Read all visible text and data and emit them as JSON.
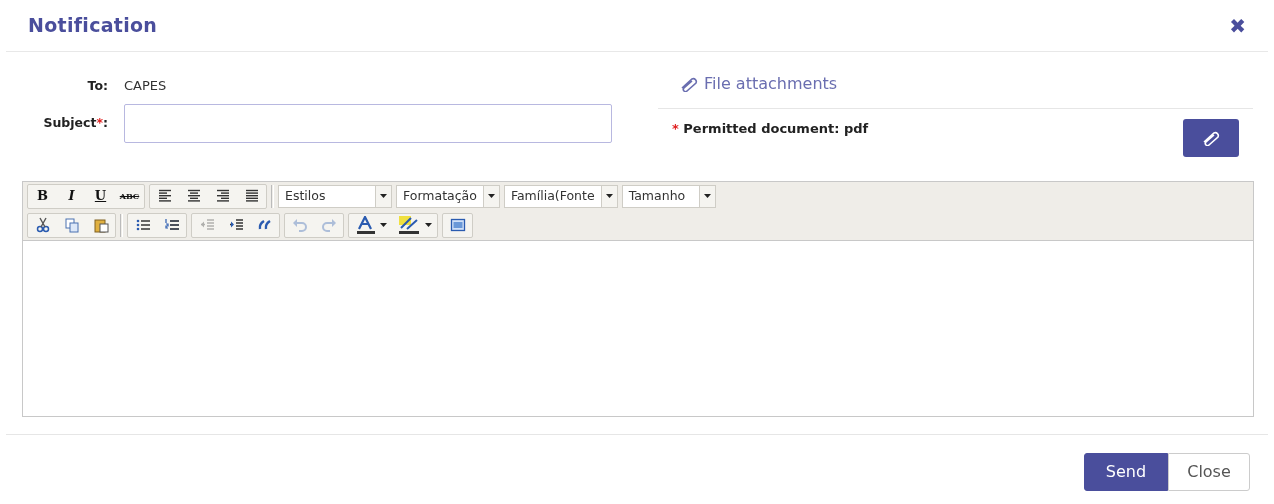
{
  "dialog": {
    "title": "Notification",
    "close_label": "✖"
  },
  "to": {
    "label": "To:",
    "value": "CAPES"
  },
  "subject": {
    "label": "Subject",
    "required_mark": "*",
    "colon": ":"
  },
  "attachments": {
    "heading": "File attachments",
    "required_mark": "*",
    "note": "Permitted document: pdf"
  },
  "editor": {
    "toolbar_rows": [
      [
        {
          "kind": "group",
          "buttons": [
            {
              "kind": "bold",
              "label": "B",
              "disabled": false
            },
            {
              "kind": "italic",
              "label": "I",
              "disabled": false
            },
            {
              "kind": "underline",
              "label": "U",
              "disabled": false
            },
            {
              "kind": "strike",
              "label": "ABC",
              "disabled": false
            }
          ]
        },
        {
          "kind": "group",
          "buttons": [
            {
              "kind": "align-left",
              "disabled": false
            },
            {
              "kind": "align-center",
              "disabled": false
            },
            {
              "kind": "align-right",
              "disabled": false
            },
            {
              "kind": "justify",
              "disabled": false
            }
          ]
        },
        {
          "kind": "separator"
        },
        {
          "kind": "combo",
          "label": "Estilos"
        },
        {
          "kind": "combo",
          "label": "Formatação"
        },
        {
          "kind": "combo",
          "label": "Família(Fonte"
        },
        {
          "kind": "combo",
          "label": "Tamanho"
        }
      ],
      [
        {
          "kind": "group",
          "buttons": [
            {
              "kind": "cut",
              "disabled": false
            },
            {
              "kind": "copy",
              "disabled": false
            },
            {
              "kind": "paste",
              "disabled": false
            }
          ]
        },
        {
          "kind": "separator"
        },
        {
          "kind": "group",
          "buttons": [
            {
              "kind": "bullets",
              "disabled": false
            },
            {
              "kind": "numbers",
              "disabled": false
            }
          ]
        },
        {
          "kind": "group",
          "buttons": [
            {
              "kind": "outdent",
              "disabled": true
            },
            {
              "kind": "indent",
              "disabled": false
            },
            {
              "kind": "quote",
              "disabled": false
            }
          ]
        },
        {
          "kind": "group",
          "buttons": [
            {
              "kind": "undo",
              "disabled": true
            },
            {
              "kind": "redo",
              "disabled": true
            }
          ]
        },
        {
          "kind": "group",
          "buttons": [
            {
              "kind": "text-color",
              "disabled": false
            },
            {
              "kind": "highlight",
              "disabled": false
            }
          ]
        },
        {
          "kind": "group",
          "buttons": [
            {
              "kind": "maximize",
              "disabled": false
            }
          ]
        }
      ]
    ]
  },
  "buttons": [
    {
      "label": "Send",
      "kind": "primary"
    },
    {
      "label": "Close",
      "kind": "secondary"
    }
  ]
}
